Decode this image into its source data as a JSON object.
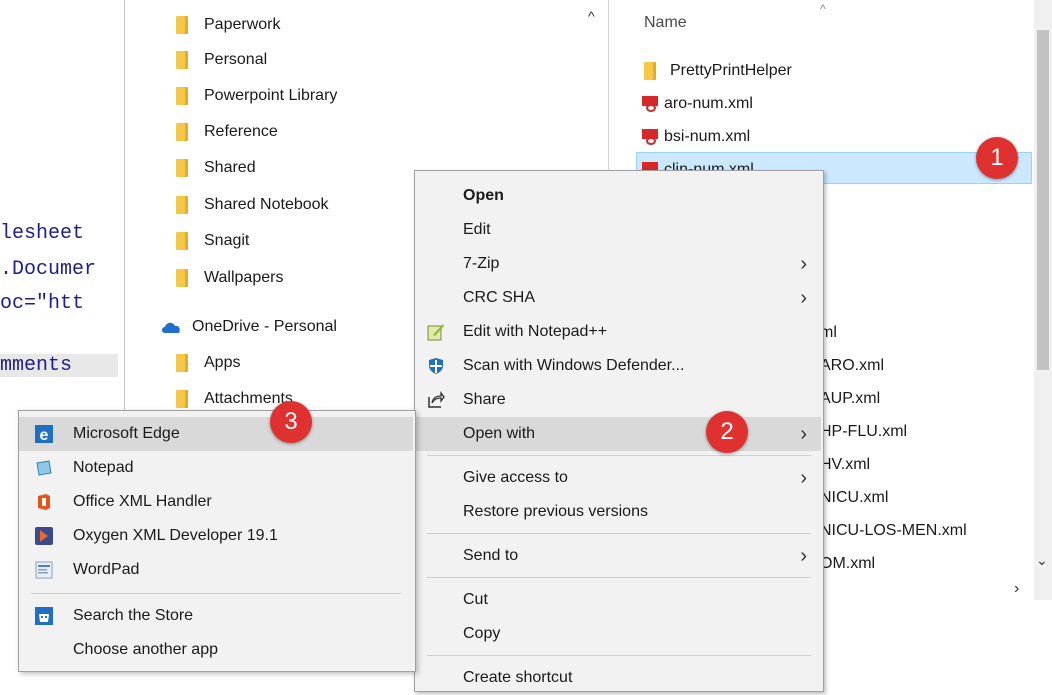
{
  "editor": {
    "lines": [
      "lesheet",
      ".Documer",
      "oc=\"htt",
      "mments"
    ]
  },
  "nav": {
    "folders": [
      "Paperwork",
      "Personal",
      "Powerpoint Library",
      "Reference",
      "Shared",
      "Shared Notebook",
      "Snagit",
      "Wallpapers"
    ],
    "onedrive_label": "OneDrive - Personal",
    "onedrive_children": [
      "Apps",
      "Attachments"
    ]
  },
  "files": {
    "column_name": "Name",
    "items": [
      "PrettyPrintHelper",
      "aro-num.xml",
      "bsi-num.xml",
      "clin-num.xml"
    ],
    "partial_items": [
      "ml",
      "ARO.xml",
      "AUP.xml",
      "HP-FLU.xml",
      "HV.xml",
      "NICU.xml",
      "NICU-LOS-MEN.xml",
      "OM.xml"
    ]
  },
  "context_menu": {
    "open": "Open",
    "edit": "Edit",
    "zip": "7-Zip",
    "crc": "CRC SHA",
    "notepadpp": "Edit with Notepad++",
    "defender": "Scan with Windows Defender...",
    "share": "Share",
    "open_with": "Open with",
    "give_access": "Give access to",
    "restore": "Restore previous versions",
    "send_to": "Send to",
    "cut": "Cut",
    "copy": "Copy",
    "create_shortcut": "Create shortcut"
  },
  "open_with_menu": {
    "apps": [
      "Microsoft Edge",
      "Notepad",
      "Office XML Handler",
      "Oxygen XML Developer 19.1",
      "WordPad"
    ],
    "store": "Search the Store",
    "other": "Choose another app"
  },
  "badges": [
    "1",
    "2",
    "3"
  ],
  "colors": {
    "selection": "#cce8ff",
    "badge": "#e03131",
    "folder": "#f5c84a",
    "menu_bg": "#f2f2f2",
    "hover": "#d9d9d9"
  }
}
